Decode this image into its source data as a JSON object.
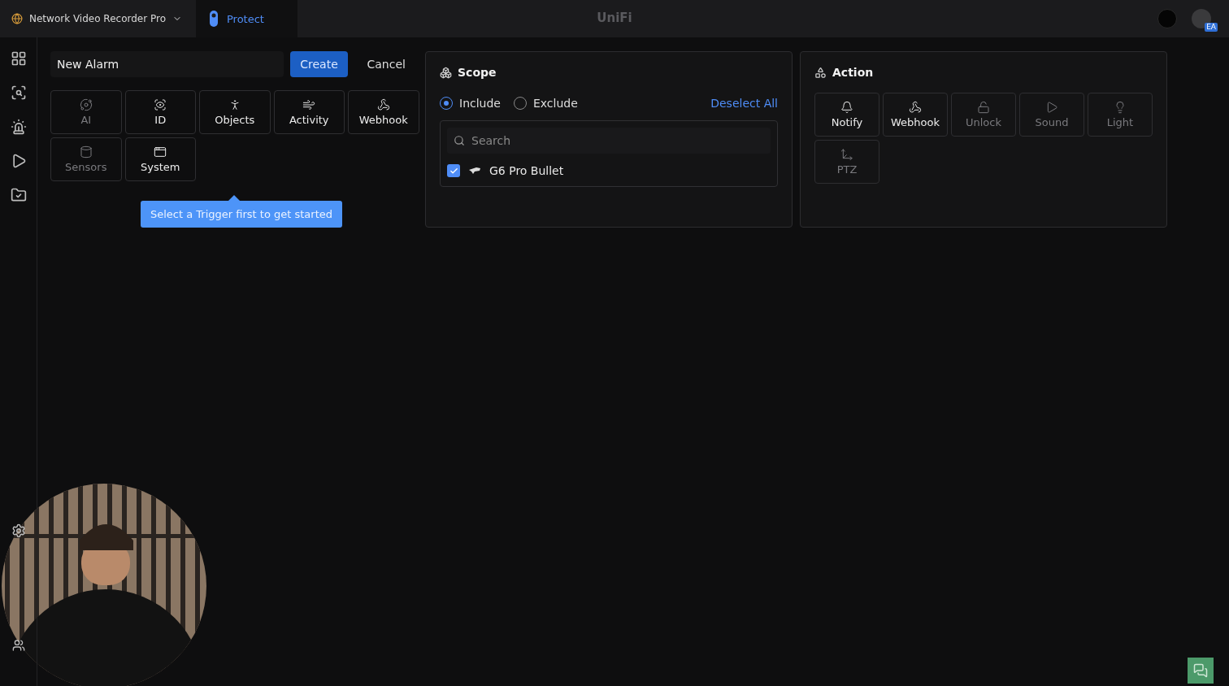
{
  "topbar": {
    "console": "Network Video Recorder Pro",
    "app": "Protect",
    "app_selected": true,
    "logo": "UniFi",
    "avatar_badge": "EA"
  },
  "alarm": {
    "name": "New Alarm",
    "create": "Create",
    "cancel": "Cancel"
  },
  "triggers": [
    {
      "label": "AI",
      "disabled": true
    },
    {
      "label": "ID",
      "disabled": false
    },
    {
      "label": "Objects",
      "disabled": false
    },
    {
      "label": "Activity",
      "disabled": false
    },
    {
      "label": "Webhook",
      "disabled": false
    },
    {
      "label": "Sensors",
      "disabled": true
    },
    {
      "label": "System",
      "disabled": false
    }
  ],
  "hint": "Select a Trigger first to get started",
  "scope": {
    "title": "Scope",
    "modes": [
      {
        "label": "Include",
        "selected": true
      },
      {
        "label": "Exclude",
        "selected": false
      }
    ],
    "deselect": "Deselect All",
    "search_placeholder": "Search",
    "devices": [
      {
        "name": "G6 Pro Bullet",
        "checked": true
      }
    ]
  },
  "action": {
    "title": "Action",
    "items": [
      {
        "label": "Notify",
        "disabled": false
      },
      {
        "label": "Webhook",
        "disabled": false
      },
      {
        "label": "Unlock",
        "disabled": true
      },
      {
        "label": "Sound",
        "disabled": true
      },
      {
        "label": "Light",
        "disabled": true
      },
      {
        "label": "PTZ",
        "disabled": true
      }
    ]
  }
}
